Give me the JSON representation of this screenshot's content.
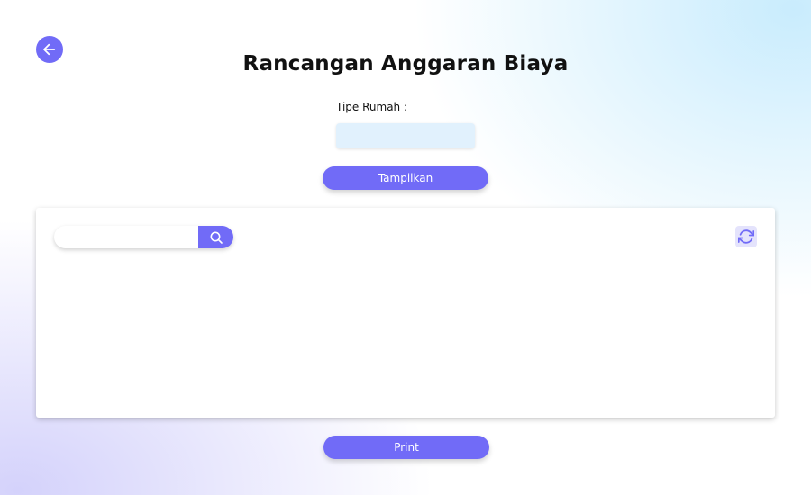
{
  "header": {
    "title": "Rancangan Anggaran Biaya",
    "back_icon": "arrow-left-icon"
  },
  "form": {
    "tipe_rumah_label": "Tipe Rumah :",
    "tipe_rumah_value": "",
    "tampilkan_label": "Tampilkan"
  },
  "panel": {
    "search_value": "",
    "search_icon": "search-icon",
    "refresh_icon": "refresh-icon",
    "rows": []
  },
  "footer": {
    "print_label": "Print"
  },
  "colors": {
    "accent": "#716bf7",
    "input_bg": "#e1f1fd",
    "refresh_bg": "#e4e3fc"
  }
}
